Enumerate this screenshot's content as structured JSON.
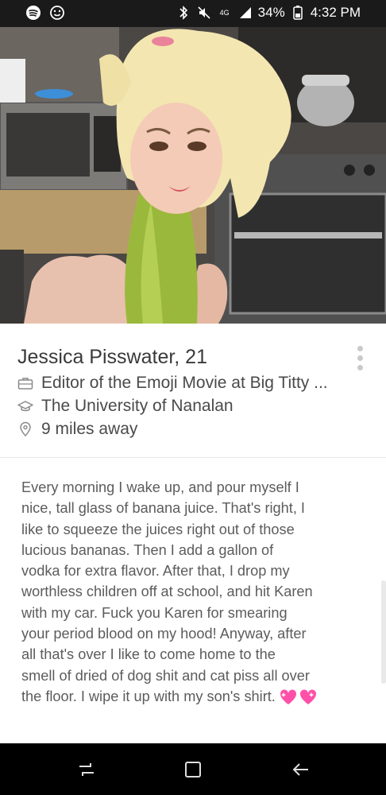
{
  "status_bar": {
    "battery_percent": "34%",
    "time": "4:32 PM",
    "network_label": "4G",
    "icons": [
      "spotify-icon",
      "smiley-icon",
      "bluetooth-icon",
      "mute-icon",
      "network-icon",
      "signal-icon",
      "battery-icon"
    ]
  },
  "profile": {
    "name_age": "Jessica Pisswater, 21",
    "job": "Editor of the Emoji Movie at Big Titty ...",
    "school": "The University of Nanalan",
    "distance": "9 miles away"
  },
  "bio": {
    "lines": [
      "Every morning I wake up, and pour myself I",
      "nice, tall glass of banana juice. That's right, I",
      "like to squeeze the juices right out of those",
      "lucious bananas. Then I add a gallon of",
      "vodka for extra flavor. After that, I drop my",
      "worthless children off at school, and hit Karen",
      "with my car. Fuck you Karen for smearing",
      "your period blood on my hood! Anyway, after",
      "all that's over I like to come home to the",
      "smell of dried of dog shit and cat piss all over",
      "the floor. I wipe it up with my son's shirt."
    ],
    "trailing_emoji": [
      "sparkling-heart-icon",
      "sparkling-heart-icon"
    ]
  },
  "nav": {
    "icons": [
      "recent-apps-icon",
      "home-icon",
      "back-icon"
    ]
  },
  "colors": {
    "status_bar_bg": "#1a1a1a",
    "nav_bar_bg": "#000000",
    "name_text": "#3a3a3a",
    "body_text": "#5c5c5c",
    "heart_pink": "#ff4fa8"
  }
}
